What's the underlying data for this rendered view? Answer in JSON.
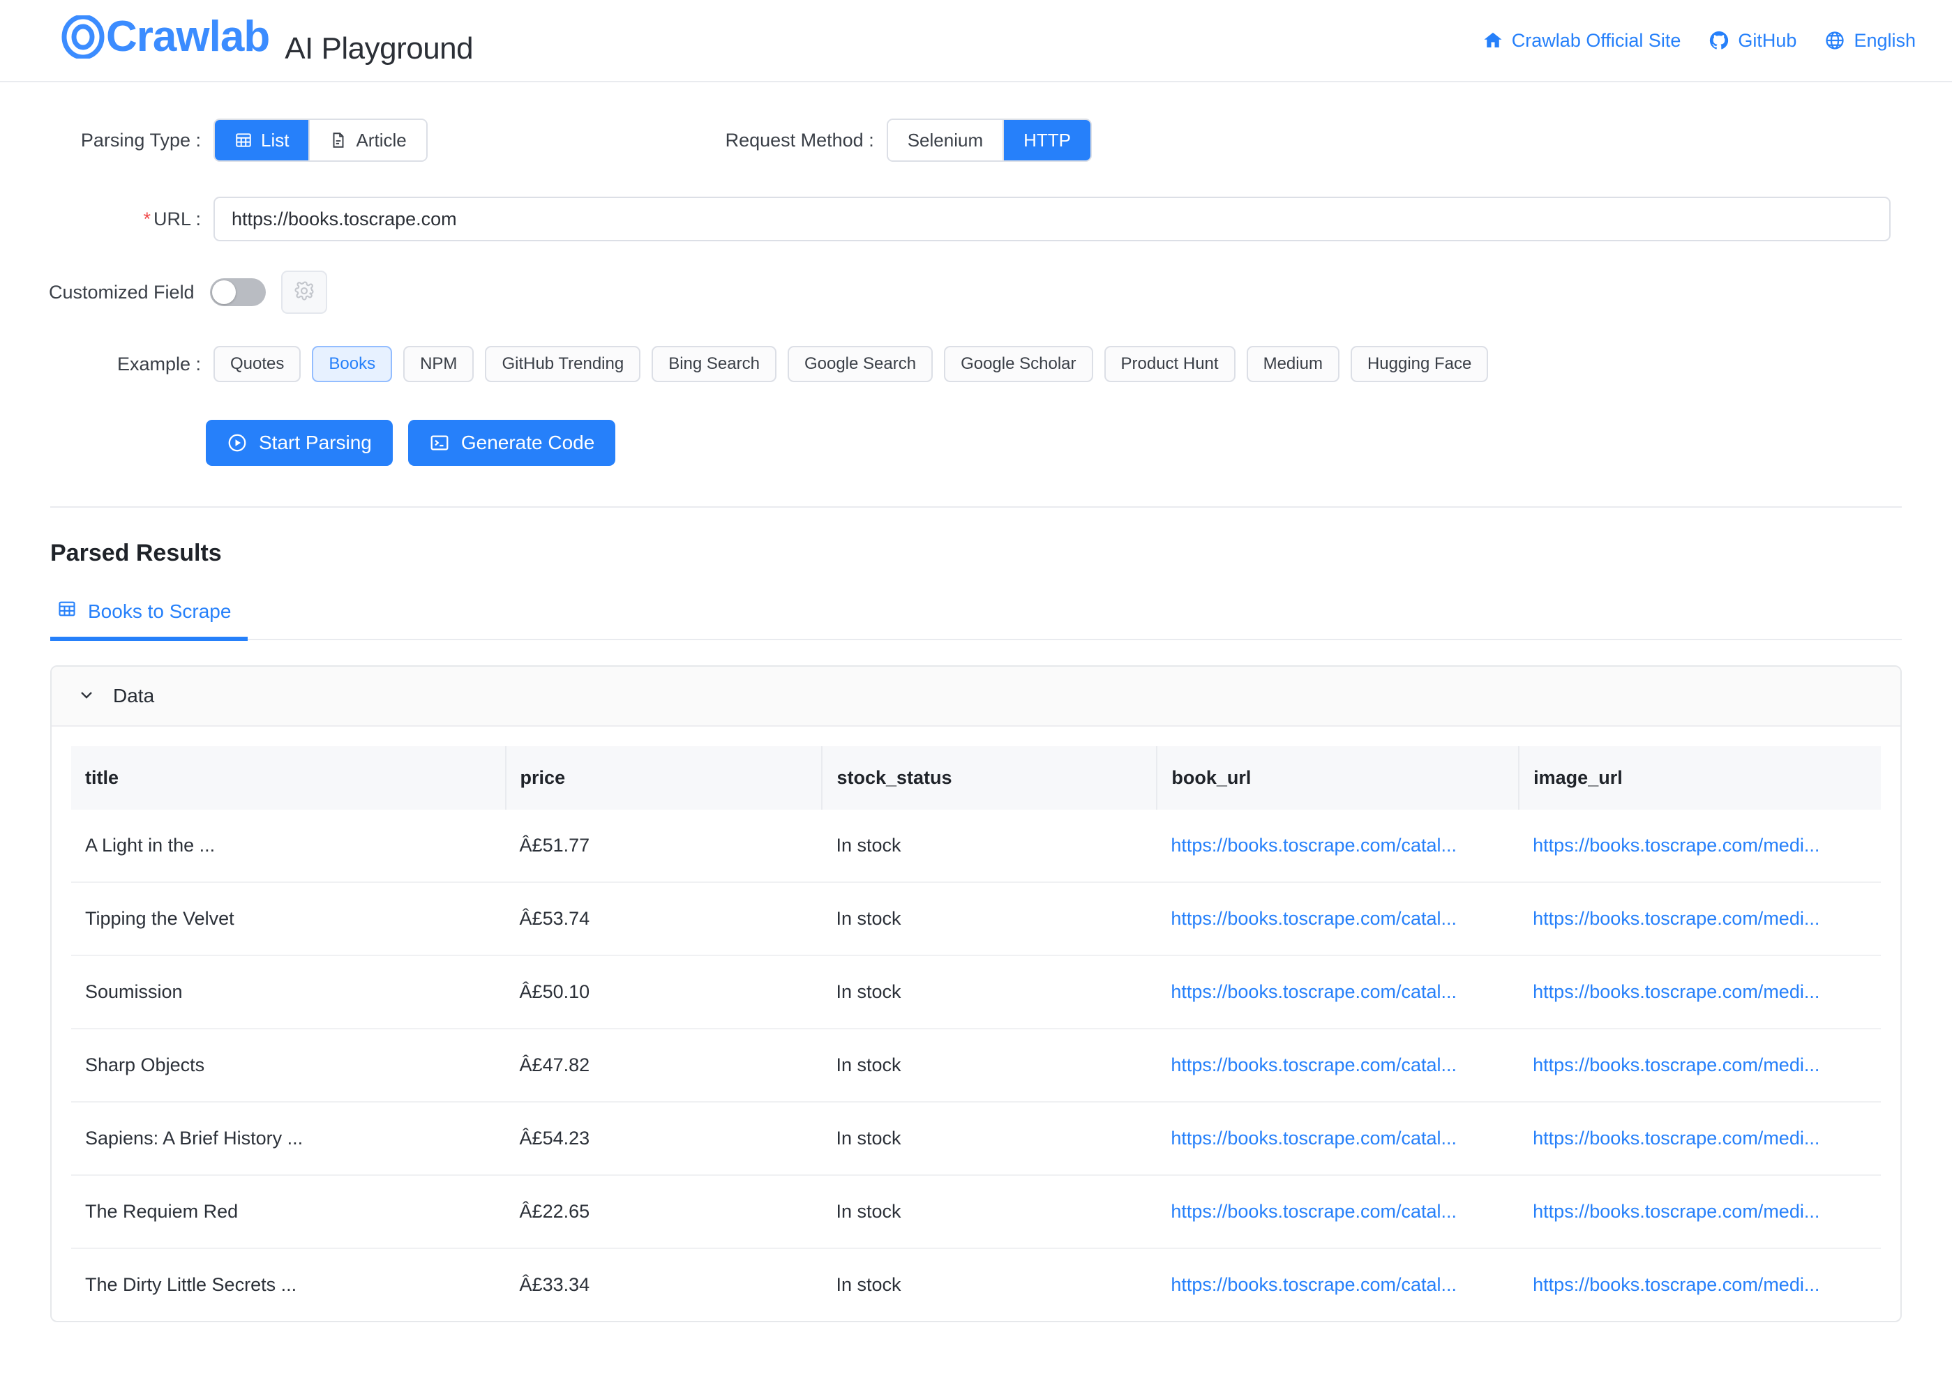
{
  "header": {
    "logo_text": "Crawlab",
    "app_title": "AI Playground",
    "links": [
      {
        "icon": "home-icon",
        "label": "Crawlab Official Site"
      },
      {
        "icon": "github-icon",
        "label": "GitHub"
      },
      {
        "icon": "globe-icon",
        "label": "English"
      }
    ]
  },
  "form": {
    "parsing_type": {
      "label": "Parsing Type :",
      "options": [
        {
          "label": "List",
          "icon": "table-grid-icon",
          "selected": true
        },
        {
          "label": "Article",
          "icon": "document-icon",
          "selected": false
        }
      ]
    },
    "request_method": {
      "label": "Request Method :",
      "options": [
        {
          "label": "Selenium",
          "selected": false
        },
        {
          "label": "HTTP",
          "selected": true
        }
      ]
    },
    "url": {
      "label": "URL :",
      "required_mark": "*",
      "value": "https://books.toscrape.com",
      "placeholder": "https://books.toscrape.com"
    },
    "customized_field": {
      "label": "Customized Field",
      "enabled": false,
      "settings_icon": "gear-icon"
    },
    "example": {
      "label": "Example :",
      "items": [
        {
          "label": "Quotes",
          "selected": false
        },
        {
          "label": "Books",
          "selected": true
        },
        {
          "label": "NPM",
          "selected": false
        },
        {
          "label": "GitHub Trending",
          "selected": false
        },
        {
          "label": "Bing Search",
          "selected": false
        },
        {
          "label": "Google Search",
          "selected": false
        },
        {
          "label": "Google Scholar",
          "selected": false
        },
        {
          "label": "Product Hunt",
          "selected": false
        },
        {
          "label": "Medium",
          "selected": false
        },
        {
          "label": "Hugging Face",
          "selected": false
        }
      ]
    },
    "actions": {
      "start_parsing": "Start Parsing",
      "generate_code": "Generate Code"
    }
  },
  "results": {
    "title": "Parsed Results",
    "tabs": [
      {
        "label": "Books to Scrape",
        "icon": "table-grid-icon",
        "active": true
      }
    ],
    "panel": {
      "title": "Data",
      "expanded": true,
      "columns": [
        "title",
        "price",
        "stock_status",
        "book_url",
        "image_url"
      ],
      "rows": [
        {
          "title": "A Light in the ...",
          "price": "Â£51.77",
          "stock_status": "In stock",
          "book_url": "https://books.toscrape.com/catal...",
          "image_url": "https://books.toscrape.com/medi..."
        },
        {
          "title": "Tipping the Velvet",
          "price": "Â£53.74",
          "stock_status": "In stock",
          "book_url": "https://books.toscrape.com/catal...",
          "image_url": "https://books.toscrape.com/medi..."
        },
        {
          "title": "Soumission",
          "price": "Â£50.10",
          "stock_status": "In stock",
          "book_url": "https://books.toscrape.com/catal...",
          "image_url": "https://books.toscrape.com/medi..."
        },
        {
          "title": "Sharp Objects",
          "price": "Â£47.82",
          "stock_status": "In stock",
          "book_url": "https://books.toscrape.com/catal...",
          "image_url": "https://books.toscrape.com/medi..."
        },
        {
          "title": "Sapiens: A Brief History ...",
          "price": "Â£54.23",
          "stock_status": "In stock",
          "book_url": "https://books.toscrape.com/catal...",
          "image_url": "https://books.toscrape.com/medi..."
        },
        {
          "title": "The Requiem Red",
          "price": "Â£22.65",
          "stock_status": "In stock",
          "book_url": "https://books.toscrape.com/catal...",
          "image_url": "https://books.toscrape.com/medi..."
        },
        {
          "title": "The Dirty Little Secrets ...",
          "price": "Â£33.34",
          "stock_status": "In stock",
          "book_url": "https://books.toscrape.com/catal...",
          "image_url": "https://books.toscrape.com/medi..."
        }
      ]
    }
  },
  "colors": {
    "accent": "#2680fa",
    "logo": "#3b8cff",
    "chip_selected_bg": "#e7f1ff",
    "text": "#1f2329",
    "border": "#dcdfe6"
  }
}
